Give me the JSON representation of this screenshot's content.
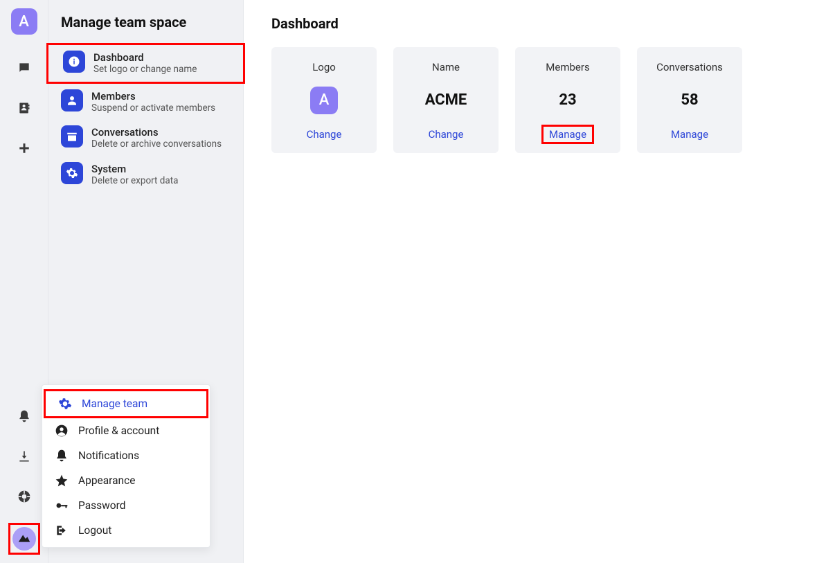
{
  "teamInitial": "A",
  "panel": {
    "title": "Manage team space",
    "items": [
      {
        "label": "Dashboard",
        "sub": "Set logo or change name"
      },
      {
        "label": "Members",
        "sub": "Suspend or activate members"
      },
      {
        "label": "Conversations",
        "sub": "Delete or archive conversations"
      },
      {
        "label": "System",
        "sub": "Delete or export data"
      }
    ]
  },
  "main": {
    "title": "Dashboard",
    "cards": {
      "logo": {
        "label": "Logo",
        "initial": "A",
        "action": "Change"
      },
      "name": {
        "label": "Name",
        "value": "ACME",
        "action": "Change"
      },
      "members": {
        "label": "Members",
        "value": "23",
        "action": "Manage"
      },
      "conversations": {
        "label": "Conversations",
        "value": "58",
        "action": "Manage"
      }
    }
  },
  "popup": {
    "items": [
      {
        "label": "Manage team"
      },
      {
        "label": "Profile & account"
      },
      {
        "label": "Notifications"
      },
      {
        "label": "Appearance"
      },
      {
        "label": "Password"
      },
      {
        "label": "Logout"
      }
    ]
  }
}
